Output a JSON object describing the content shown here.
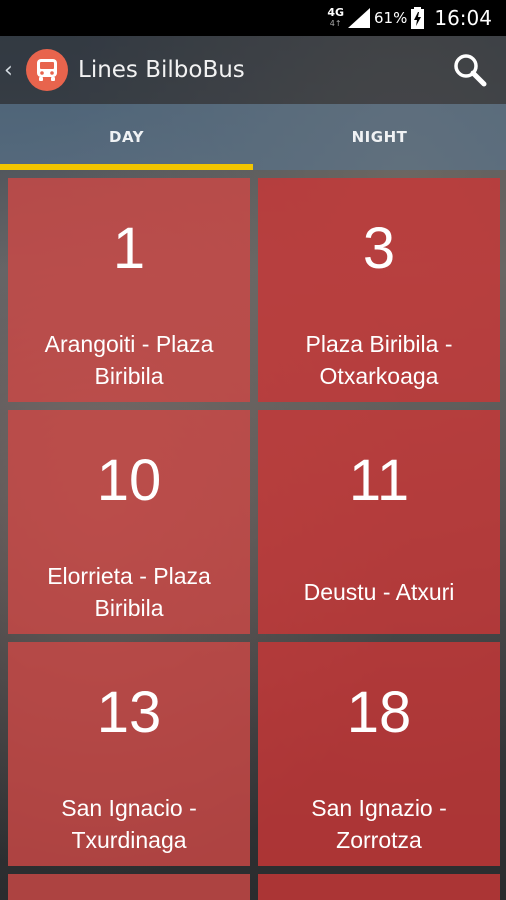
{
  "status_bar": {
    "network": "4G",
    "network_sub": "4↑",
    "battery": "61%",
    "time": "16:04"
  },
  "app_bar": {
    "up_glyph": "‹",
    "title": "Lines BilboBus",
    "logo_icon": "bus-icon",
    "search_icon": "search-icon"
  },
  "tabs": [
    {
      "label": "DAY",
      "active": true
    },
    {
      "label": "NIGHT",
      "active": false
    }
  ],
  "lines": [
    {
      "number": "1",
      "route": "Arangoiti - Plaza Biribila"
    },
    {
      "number": "3",
      "route": "Plaza Biribila - Otxarkoaga"
    },
    {
      "number": "10",
      "route": "Elorrieta - Plaza Biribila"
    },
    {
      "number": "11",
      "route": "Deustu - Atxuri"
    },
    {
      "number": "13",
      "route": "San Ignacio - Txurdinaga"
    },
    {
      "number": "18",
      "route": "San Ignazio - Zorrotza"
    }
  ],
  "colors": {
    "tile": "#c83737",
    "tab_indicator": "#f2c500",
    "logo": "#e8644d"
  }
}
